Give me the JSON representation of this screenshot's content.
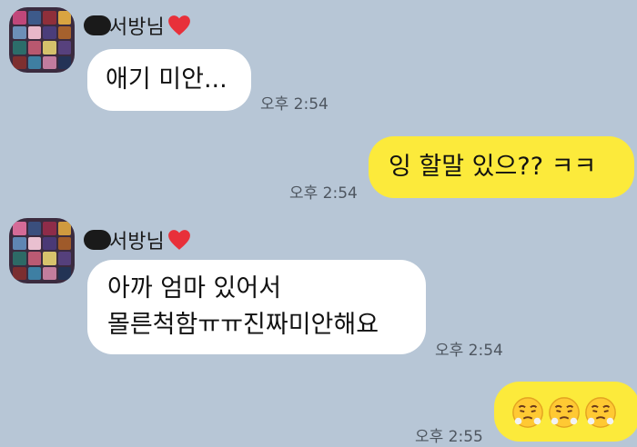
{
  "messages": [
    {
      "sender": "서방님",
      "text": "애기 미안...",
      "time": "오후 2:54"
    },
    {
      "mine": true,
      "text": "잉 할말 있으?? ㅋㅋ",
      "time": "오후 2:54"
    },
    {
      "sender": "서방님",
      "lines": [
        "아까 엄마 있어서",
        "몰른척함ㅠㅠ진짜미안해요"
      ],
      "time": "오후 2:54"
    },
    {
      "mine": true,
      "emoji": [
        "steam-from-nose-emoji",
        "steam-from-nose-emoji",
        "steam-from-nose-emoji"
      ],
      "time": "오후 2:55"
    }
  ],
  "colors": {
    "background": "#b7c6d6",
    "own_bubble": "#fcea3b",
    "other_bubble": "#ffffff",
    "heart": "#e8303a"
  }
}
